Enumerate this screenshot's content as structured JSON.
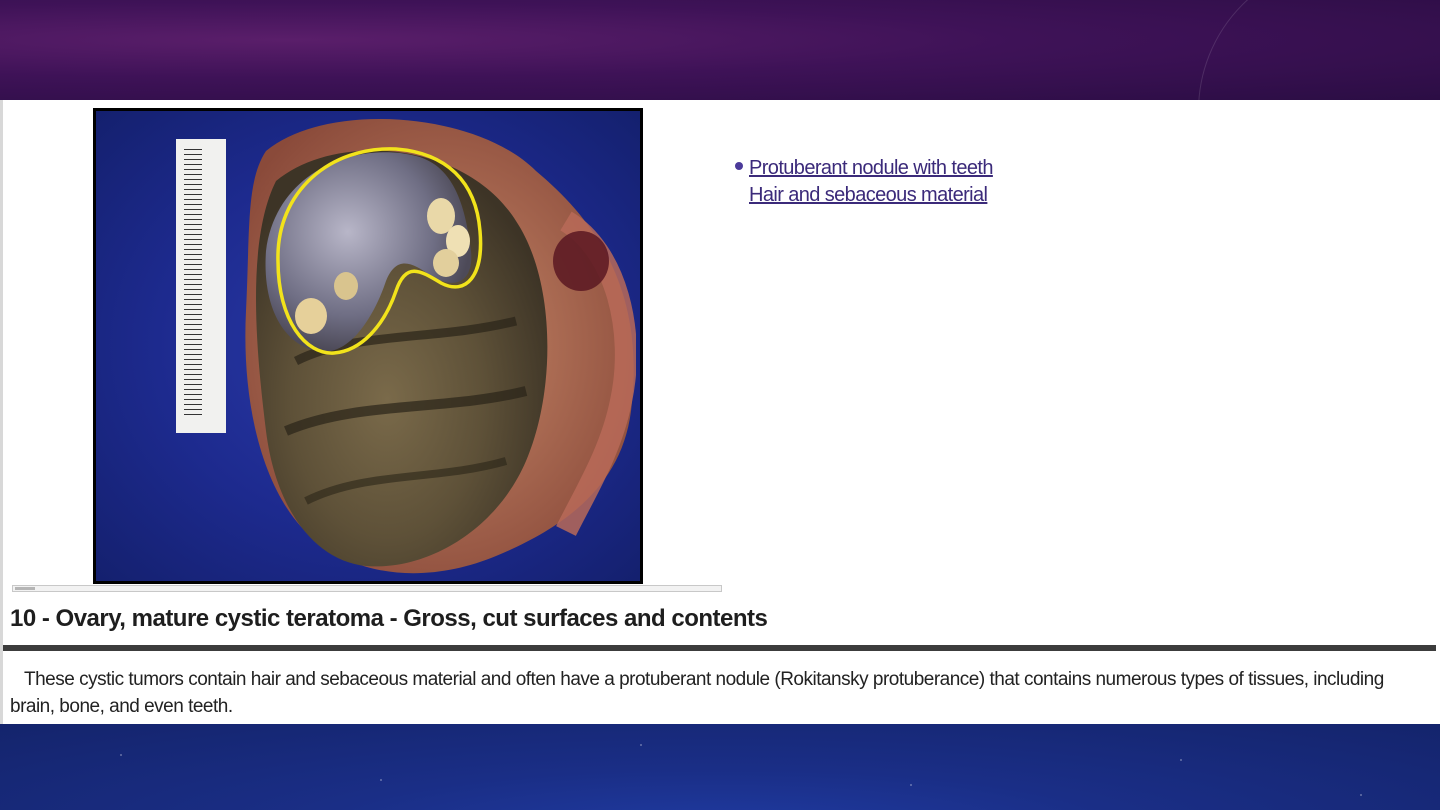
{
  "figure": {
    "bullet_items": [
      "Protuberant nodule with teeth",
      "Hair and sebaceous material"
    ],
    "title": "10 - Ovary, mature cystic teratoma - Gross, cut surfaces and contents",
    "description": "These cystic tumors contain hair and sebaceous material and often have a protuberant nodule (Rokitansky protuberance) that contains numerous types of tissues, including brain, bone, and even teeth.",
    "annotation_color": "#f2e31b",
    "photo_background_color": "#1f2c92"
  },
  "theme": {
    "top_band_color": "#3e1257",
    "bottom_band_color": "#1a2e86"
  }
}
